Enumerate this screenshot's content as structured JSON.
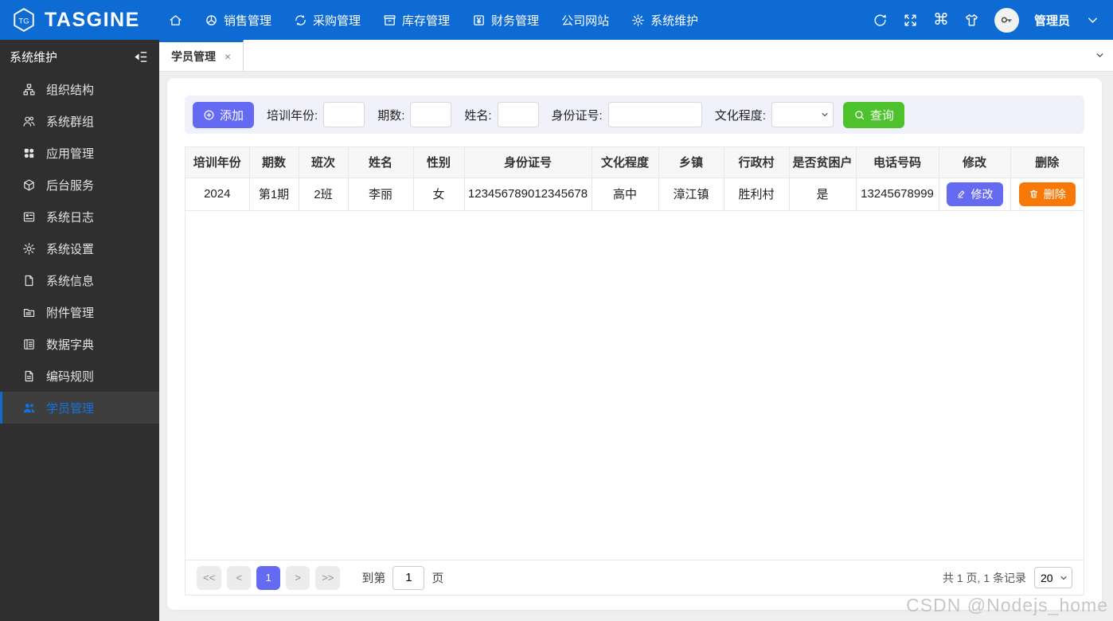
{
  "topbar": {
    "brand": "TASGINE",
    "nav": [
      {
        "label": "",
        "icon": "home-icon"
      },
      {
        "label": "销售管理",
        "icon": "sales-icon"
      },
      {
        "label": "采购管理",
        "icon": "purchase-icon"
      },
      {
        "label": "库存管理",
        "icon": "inventory-icon"
      },
      {
        "label": "财务管理",
        "icon": "finance-icon"
      },
      {
        "label": "公司网站",
        "icon": "none"
      },
      {
        "label": "系统维护",
        "icon": "gear-icon"
      }
    ],
    "right_icons": [
      "refresh-icon",
      "fullscreen-icon",
      "command-icon",
      "theme-shirt-icon"
    ],
    "user": {
      "name": "管理员"
    }
  },
  "sidebar": {
    "title": "系统维护",
    "collapse_icon": "collapse-menu-icon",
    "items": [
      {
        "label": "组织结构",
        "icon": "org-structure-icon"
      },
      {
        "label": "系统群组",
        "icon": "user-group-icon"
      },
      {
        "label": "应用管理",
        "icon": "apps-icon"
      },
      {
        "label": "后台服务",
        "icon": "cube-icon"
      },
      {
        "label": "系统日志",
        "icon": "log-icon"
      },
      {
        "label": "系统设置",
        "icon": "gear-icon"
      },
      {
        "label": "系统信息",
        "icon": "file-info-icon"
      },
      {
        "label": "附件管理",
        "icon": "folder-icon"
      },
      {
        "label": "数据字典",
        "icon": "dictionary-icon"
      },
      {
        "label": "编码规则",
        "icon": "file-code-icon"
      },
      {
        "label": "学员管理",
        "icon": "students-icon",
        "active": true
      }
    ]
  },
  "tabs": {
    "active_label": "学员管理",
    "close": "×"
  },
  "filter": {
    "add_label": "添加",
    "fields": [
      {
        "label": "培训年份:",
        "value": ""
      },
      {
        "label": "期数:",
        "value": ""
      },
      {
        "label": "姓名:",
        "value": ""
      },
      {
        "label": "身份证号:",
        "value": ""
      }
    ],
    "select_label": "文化程度:",
    "select_value": "",
    "search_label": "查询"
  },
  "table": {
    "headers": [
      "培训年份",
      "期数",
      "班次",
      "姓名",
      "性别",
      "身份证号",
      "文化程度",
      "乡镇",
      "行政村",
      "是否贫困户",
      "电话号码",
      "修改",
      "删除"
    ],
    "rows": [
      {
        "cells": [
          "2024",
          "第1期",
          "2班",
          "李丽",
          "女",
          "123456789012345678",
          "高中",
          "漳江镇",
          "胜利村",
          "是",
          "13245678999"
        ],
        "edit_label": "修改",
        "delete_label": "删除"
      }
    ]
  },
  "pagination": {
    "first": "<<",
    "prev": "<",
    "page": "1",
    "next": ">",
    "last": ">>",
    "goto_prefix": "到第",
    "goto_value": "1",
    "goto_suffix": "页",
    "summary": "共 1 页, 1 条记录",
    "page_size": "20"
  },
  "watermark": "CSDN @Nodejs_home",
  "colors": {
    "topbar_blue": "#0d6bd3",
    "accent_indigo": "#656af2",
    "search_green": "#4ec22d",
    "delete_orange": "#f87907",
    "sidebar_bg": "#2f2f2f",
    "filter_bg": "#f0f1fa"
  }
}
